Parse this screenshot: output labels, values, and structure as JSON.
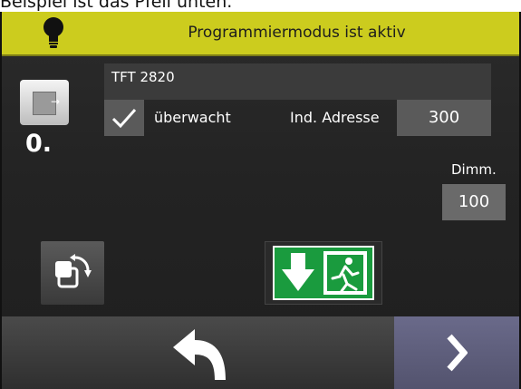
{
  "caption": "Beispiel ist das Pfeil unten.",
  "topbar": {
    "icon": "lightbulb-icon",
    "title": "Programmiermodus ist aktiv"
  },
  "device": {
    "icon": "emergency-exit-device-icon",
    "number": "0."
  },
  "form": {
    "name": "TFT 2820",
    "monitored_checked": true,
    "monitored_label": "überwacht",
    "address_label": "Ind. Adresse",
    "address_value": "300",
    "dimm_label": "Dimm.",
    "dimm_value": "100"
  },
  "actions": {
    "rotate_icon": "rotate-icon",
    "sign_icon": "exit-sign-arrow-down-icon"
  },
  "nav": {
    "back_icon": "back-arrow-icon",
    "next_icon": "chevron-right-icon"
  },
  "colors": {
    "topbar": "#cccc1e",
    "sign_green": "#1a9b3e",
    "next": "#5e5e7c"
  }
}
